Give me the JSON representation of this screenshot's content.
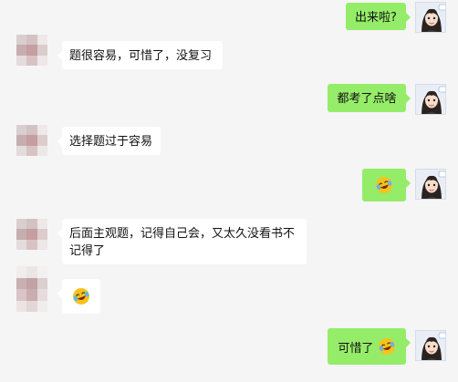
{
  "messages": [
    {
      "side": "right",
      "text": "出来啦?",
      "emoji": false
    },
    {
      "side": "left",
      "text": "题很容易，可惜了，没复习",
      "emoji": false
    },
    {
      "side": "right",
      "text": "都考了点啥",
      "emoji": false
    },
    {
      "side": "left",
      "text": "选择题过于容易",
      "emoji": false
    },
    {
      "side": "right",
      "text": "",
      "emoji": true
    },
    {
      "side": "left",
      "text_line1": "后面主观题，记得自己会，又太久没看书不",
      "text_line2": "记得了",
      "emoji": false
    },
    {
      "side": "left",
      "text": "",
      "emoji": true
    },
    {
      "side": "right",
      "text": "可惜了",
      "emoji": true
    }
  ],
  "icons": {
    "emoji": "laughing-crying-emoji-icon",
    "self_avatar": "cartoon-girl-avatar-icon",
    "other_avatar": "pixelated-avatar-icon"
  },
  "colors": {
    "background": "#f5f5f5",
    "sent_bubble": "#95ec69",
    "received_bubble": "#ffffff"
  }
}
